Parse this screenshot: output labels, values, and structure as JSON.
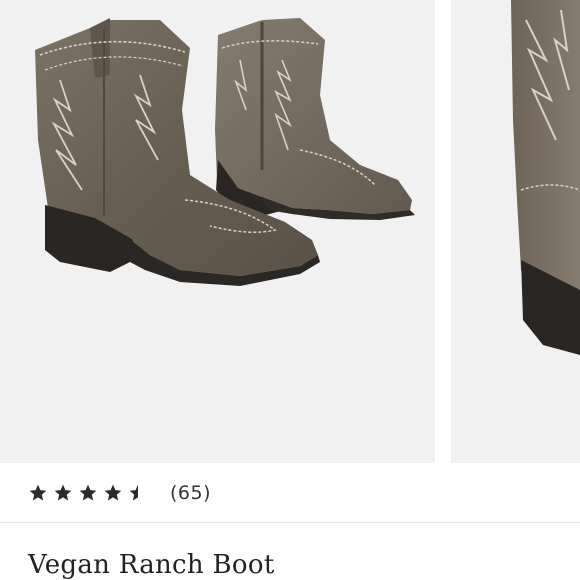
{
  "gallery": {
    "images": [
      {
        "subject": "boot-pair-image",
        "alt": ""
      },
      {
        "subject": "boot-closeup-image",
        "alt": ""
      }
    ]
  },
  "rating": {
    "value": 4.5,
    "max": 5,
    "count_text": "(65)"
  },
  "product": {
    "title": "Vegan Ranch Boot"
  },
  "colors": {
    "leather": "#6e6558",
    "stitching": "#d8d2c4",
    "heel": "#2a2623",
    "star": "#2b2b2b",
    "background": "#f1f1f1"
  }
}
